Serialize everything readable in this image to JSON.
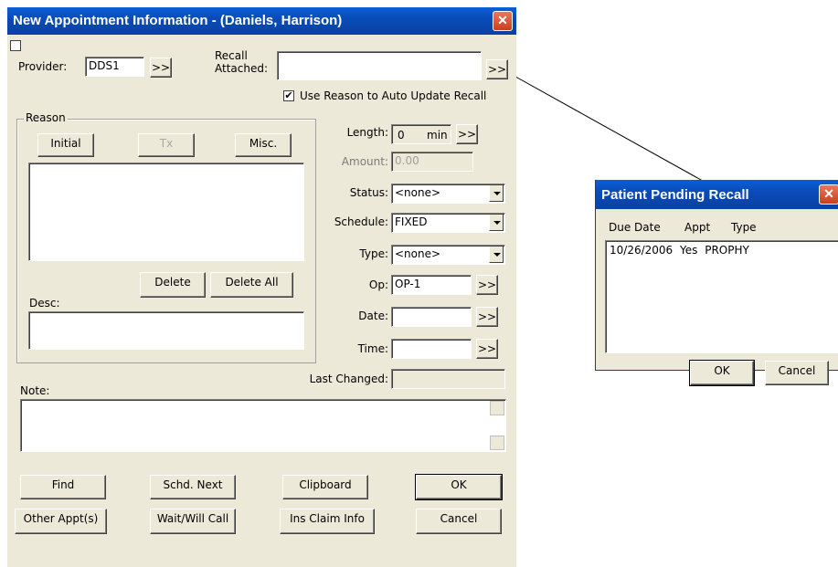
{
  "main_window": {
    "title": "New Appointment Information - (Daniels, Harrison)",
    "close_glyph": "✕",
    "provider_label": "Provider:",
    "provider_value": "DDS1",
    "recall_label_line1": "Recall",
    "recall_label_line2": "Attached:",
    "recall_value": "",
    "use_reason_label": "Use Reason to Auto Update Recall",
    "use_reason_checked": "✔",
    "more_glyph": ">>",
    "reason_group_label": "Reason",
    "initial_button": "Initial",
    "tx_button": "Tx",
    "misc_button": "Misc.",
    "delete_button": "Delete",
    "delete_all_button": "Delete All",
    "desc_label": "Desc:",
    "length_label": "Length:",
    "length_value": "0",
    "length_unit": "min",
    "amount_label": "Amount:",
    "amount_value": "0.00",
    "status_label": "Status:",
    "status_value": "<none>",
    "schedule_label": "Schedule:",
    "schedule_value": "FIXED",
    "type_label": "Type:",
    "type_value": "<none>",
    "op_label": "Op:",
    "op_value": "OP-1",
    "date_label": "Date:",
    "date_value": "",
    "time_label": "Time:",
    "time_value": "",
    "last_changed_label": "Last Changed:",
    "last_changed_value": "",
    "note_label": "Note:",
    "find_button": "Find",
    "schd_next_button": "Schd. Next",
    "clipboard_button": "Clipboard",
    "ok_button": "OK",
    "other_appts_button": "Other Appt(s)",
    "wait_will_call_button": "Wait/Will Call",
    "ins_claim_info_button": "Ins Claim Info",
    "cancel_button": "Cancel"
  },
  "recall_window": {
    "title": "Patient Pending Recall",
    "close_glyph": "✕",
    "columns": [
      "Due Date",
      "Appt",
      "Type"
    ],
    "rows": [
      {
        "due_date": "10/26/2006",
        "appt": "Yes",
        "type": "PROPHY"
      }
    ],
    "ok_button": "OK",
    "cancel_button": "Cancel"
  },
  "colors": {
    "titlebar": "#0a4bb8",
    "dialog_bg": "#ece9d8"
  }
}
